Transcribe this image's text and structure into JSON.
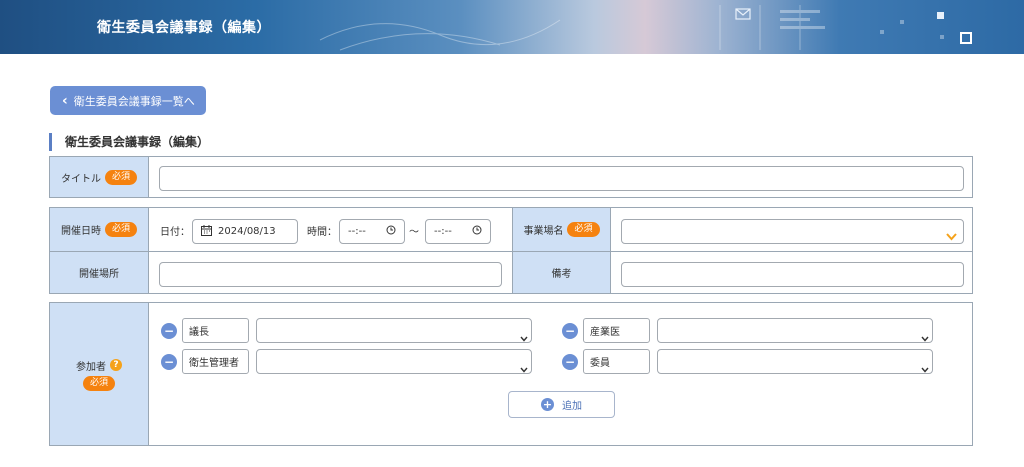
{
  "header": {
    "title": "衛生委員会議事録（編集）"
  },
  "back_button": {
    "label": "衛生委員会議事録一覧へ"
  },
  "section": {
    "title": "衛生委員会議事録（編集）"
  },
  "required_badge": "必須",
  "title_row": {
    "label": "タイトル",
    "value": ""
  },
  "datetime_row": {
    "label": "開催日時",
    "date_label": "日付：",
    "date_value": "2024/08/13",
    "time_label": "時間：",
    "time_start": "--:--",
    "tilde": "〜",
    "time_end": "--:--"
  },
  "workplace_row": {
    "label": "事業場名",
    "value": ""
  },
  "location_row": {
    "label": "開催場所",
    "value": ""
  },
  "remarks_row": {
    "label": "備考",
    "value": ""
  },
  "participants": {
    "label": "参加者",
    "help": "?",
    "items": [
      {
        "role": "議長",
        "value": ""
      },
      {
        "role": "産業医",
        "value": ""
      },
      {
        "role": "衛生管理者",
        "value": ""
      },
      {
        "role": "委員",
        "value": ""
      }
    ],
    "add_label": "追加"
  }
}
